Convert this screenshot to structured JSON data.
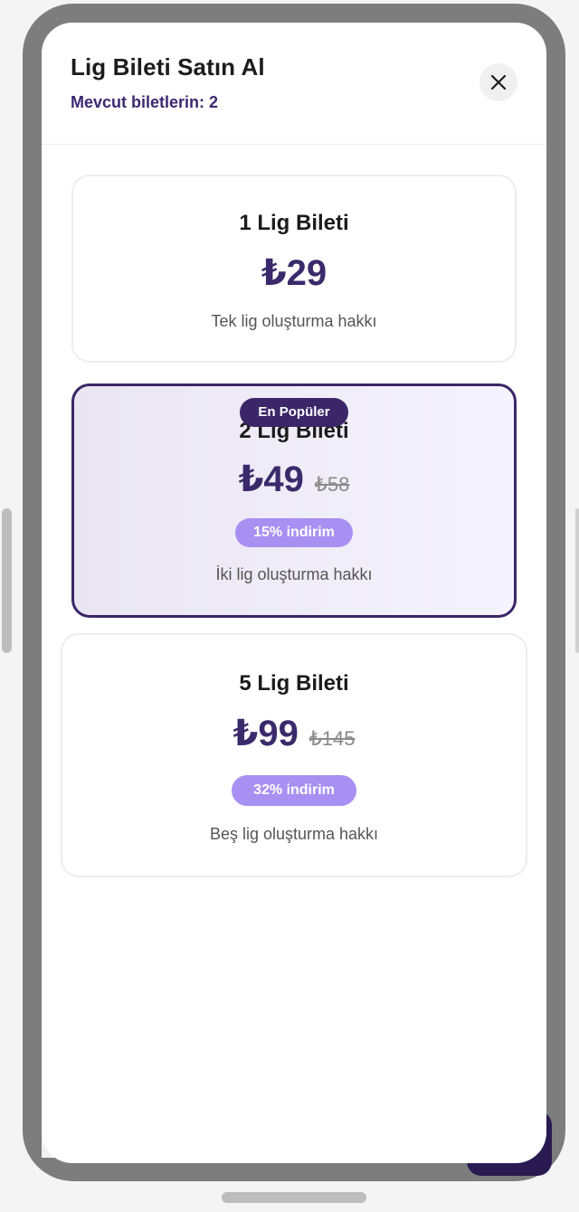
{
  "modal": {
    "title": "Lig Bileti Satın Al",
    "tickets_owned": "Mevcut biletlerin: 2",
    "close_icon": "close-icon"
  },
  "packages": [
    {
      "title": "1 Lig Bileti",
      "price": "₺29",
      "old_price": "",
      "discount": "",
      "description": "Tek lig oluşturma hakkı",
      "highlighted": false
    },
    {
      "title": "2 Lig Bileti",
      "price": "₺49",
      "old_price": "₺58",
      "discount": "15% indirim",
      "description": "İki lig oluşturma hakkı",
      "badge": "En Popüler",
      "highlighted": true
    },
    {
      "title": "5 Lig Bileti",
      "price": "₺99",
      "old_price": "₺145",
      "discount": "32% indirim",
      "description": "Beş lig oluşturma hakkı",
      "highlighted": false
    }
  ],
  "colors": {
    "brand": "#3b2668",
    "discount_badge": "#a890f2",
    "highlight_bg_start": "#e9e6f2",
    "highlight_bg_end": "#f5f3fd"
  }
}
